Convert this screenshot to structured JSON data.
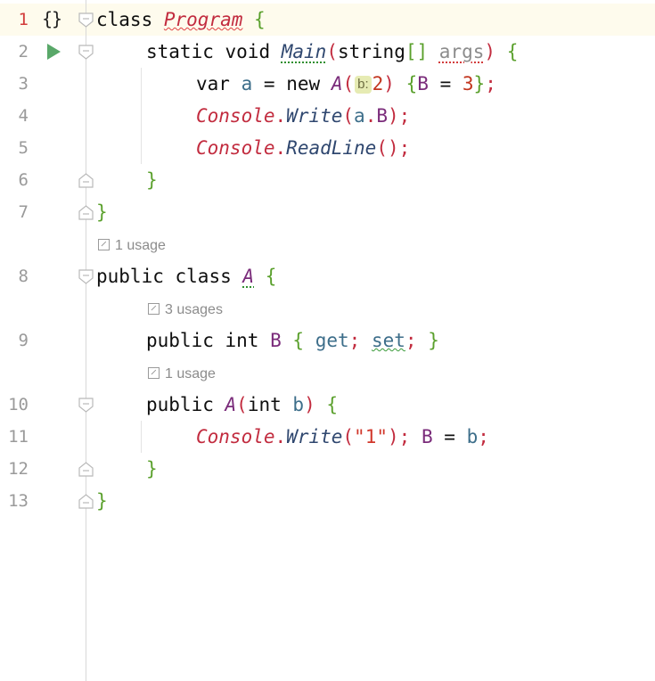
{
  "editor": {
    "lines": [
      {
        "num": "1",
        "tokens": [
          "class",
          "Program",
          "{"
        ]
      },
      {
        "num": "2",
        "tokens": [
          "static",
          "void",
          "Main",
          "(",
          "string",
          "[]",
          "args",
          ")",
          "{"
        ]
      },
      {
        "num": "3",
        "tokens": [
          "var",
          "a",
          "=",
          "new",
          "A",
          "(",
          "b:",
          "2",
          ")",
          "{",
          "B",
          "=",
          "3",
          "}",
          ";"
        ]
      },
      {
        "num": "4",
        "tokens": [
          "Console",
          ".",
          "Write",
          "(",
          "a",
          ".",
          "B",
          ")",
          ";"
        ]
      },
      {
        "num": "5",
        "tokens": [
          "Console",
          ".",
          "ReadLine",
          "(",
          ")",
          ";"
        ]
      },
      {
        "num": "6",
        "tokens": [
          "}"
        ]
      },
      {
        "num": "7",
        "tokens": [
          "}"
        ]
      },
      {
        "num": "8",
        "tokens": [
          "public",
          "class",
          "A",
          "{"
        ]
      },
      {
        "num": "9",
        "tokens": [
          "public",
          "int",
          "B",
          "{",
          "get",
          ";",
          "set",
          ";",
          "}"
        ]
      },
      {
        "num": "10",
        "tokens": [
          "public",
          "A",
          "(",
          "int",
          "b",
          ")",
          "{"
        ]
      },
      {
        "num": "11",
        "tokens": [
          "Console",
          ".",
          "Write",
          "(",
          "\"1\"",
          ")",
          ";",
          "B",
          "=",
          "b",
          ";"
        ]
      },
      {
        "num": "12",
        "tokens": [
          "}"
        ]
      },
      {
        "num": "13",
        "tokens": [
          "}"
        ]
      }
    ],
    "hints": {
      "class_a": "1 usage",
      "prop_b": "3 usages",
      "ctor_a": "1 usage"
    },
    "gutter_icons": {
      "line1": "code-braces-icon",
      "line2": "run-icon"
    }
  }
}
